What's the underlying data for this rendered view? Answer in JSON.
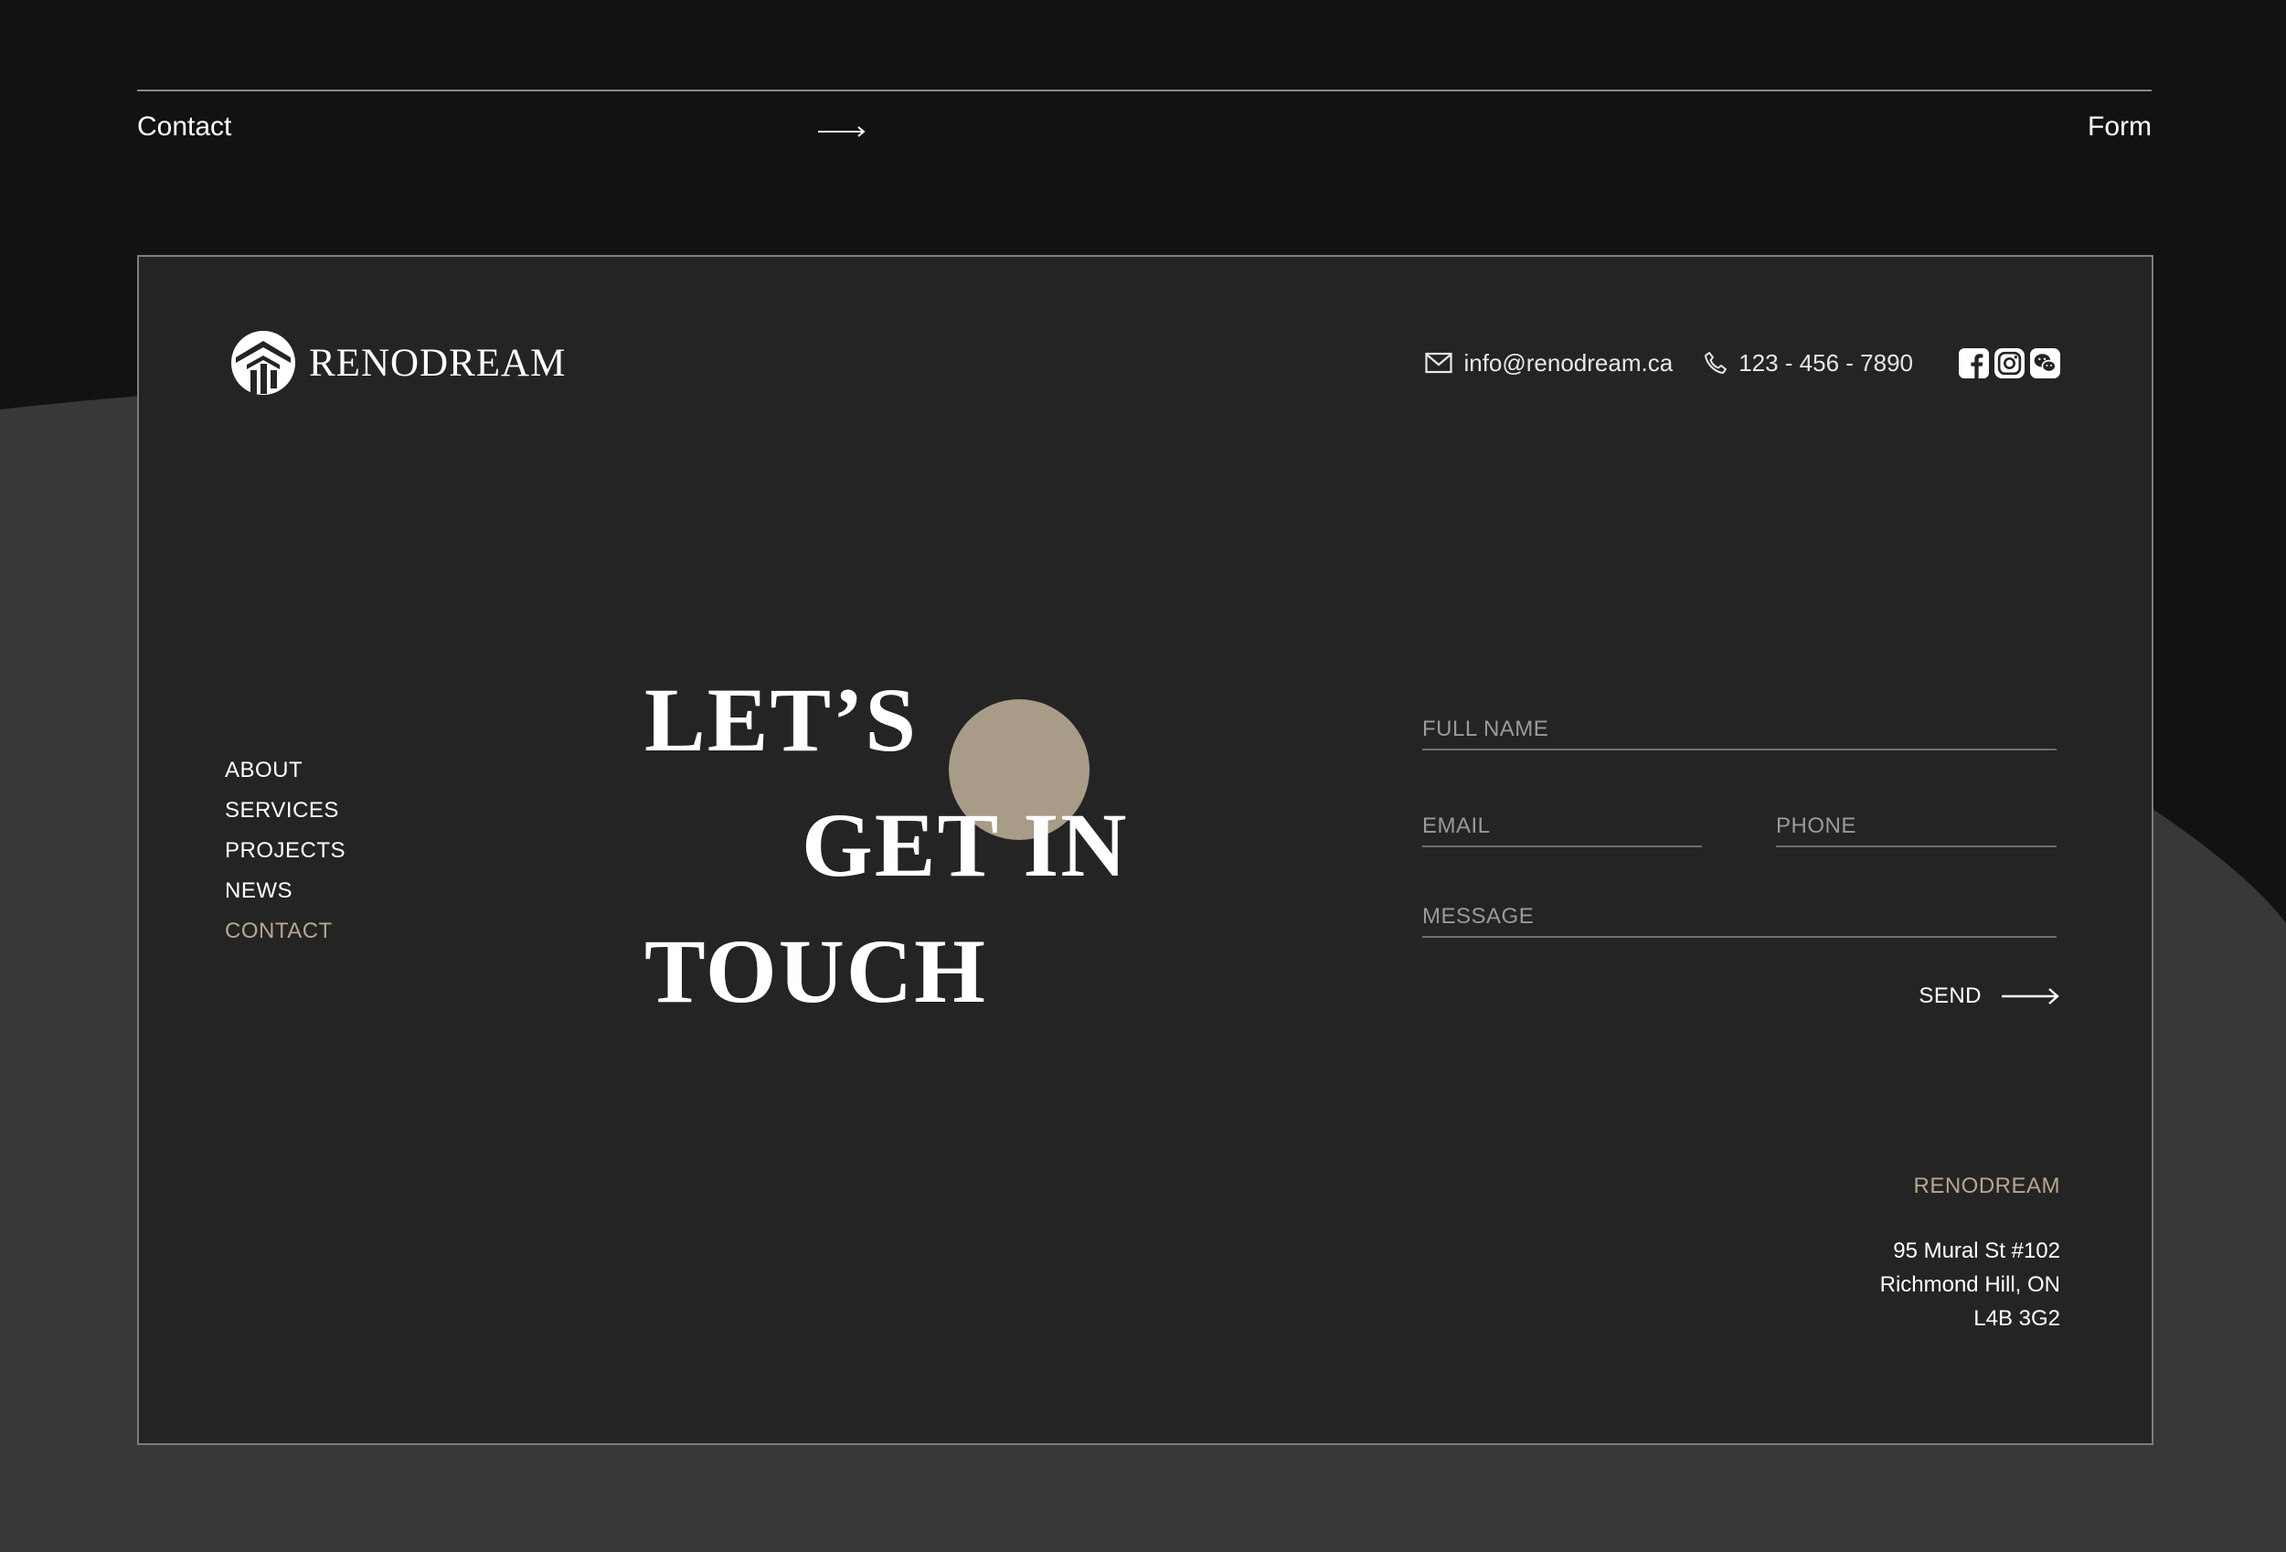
{
  "topbar": {
    "left_label": "Contact",
    "right_label": "Form"
  },
  "brand": {
    "name": "RENODREAM",
    "logo_icon": "renodream-logo-icon"
  },
  "contact": {
    "email": "info@renodream.ca",
    "phone": "123 - 456 - 7890",
    "social_icons": [
      "facebook-icon",
      "instagram-icon",
      "wechat-icon"
    ]
  },
  "nav": {
    "items": [
      {
        "label": "ABOUT"
      },
      {
        "label": "SERVICES"
      },
      {
        "label": "PROJECTS"
      },
      {
        "label": "NEWS"
      },
      {
        "label": "CONTACT",
        "active": true
      }
    ]
  },
  "headline": {
    "line1": "LET’S",
    "line2": "GET IN",
    "line3": "TOUCH"
  },
  "form": {
    "full_name_placeholder": "FULL NAME",
    "email_placeholder": "EMAIL",
    "phone_placeholder": "PHONE",
    "message_placeholder": "MESSAGE",
    "send_label": "SEND"
  },
  "address": {
    "company": "RENODREAM",
    "street": "95 Mural St #102",
    "city": "Richmond Hill, ON",
    "postal": "L4B 3G2"
  },
  "colors": {
    "background": "#121212",
    "panel": "#242424",
    "wave": "#383838",
    "accent": "#b6a78f",
    "dot": "#a89c88"
  }
}
